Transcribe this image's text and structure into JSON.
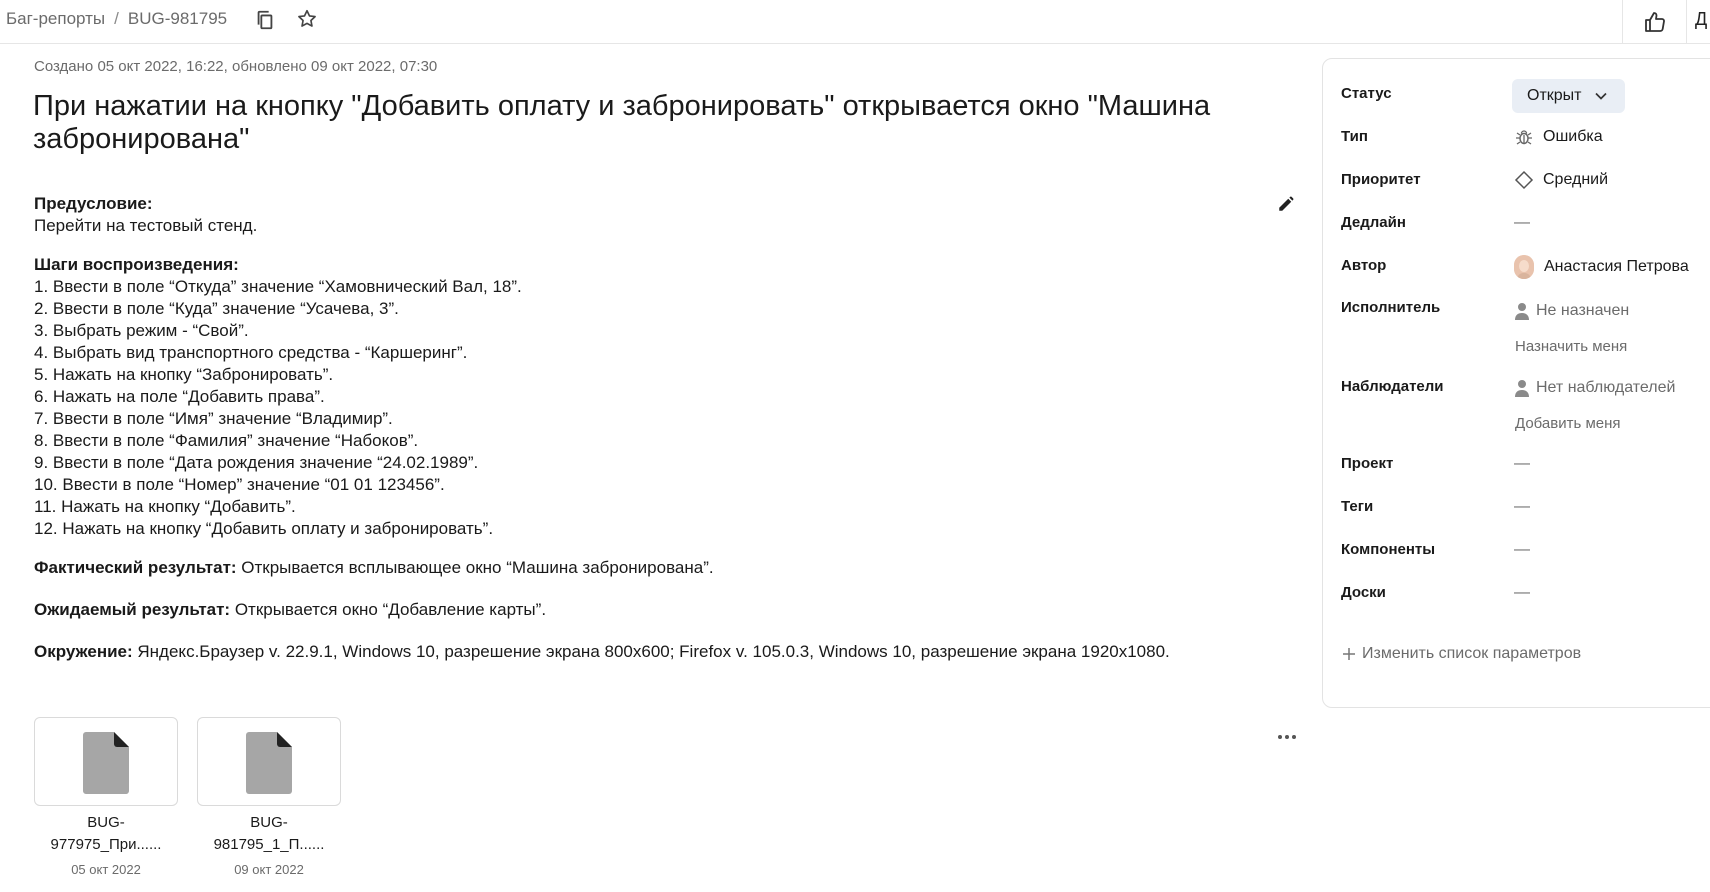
{
  "breadcrumb": {
    "section": "Баг-репорты",
    "separator": "/",
    "issue_key": "BUG-981795"
  },
  "topbar": {
    "edge_button_label": "Д"
  },
  "meta": {
    "text": "Создано 05 окт 2022, 16:22, обновлено 09 окт 2022, 07:30"
  },
  "title": "При нажатии на кнопку \"Добавить оплату и забронировать\" открывается окно \"Машина забронирована\"",
  "description": {
    "precondition_label": "Предусловие:",
    "precondition_text": "Перейти на тестовый стенд.",
    "steps_label": "Шаги воспроизведения:",
    "steps": [
      "1. Ввести в поле “Откуда” значение “Хамовнический Вал, 18”.",
      "2. Ввести в поле “Куда” значение “Усачева, 3”.",
      "3. Выбрать режим - “Свой”.",
      "4. Выбрать вид транспортного средства - “Каршеринг”.",
      "5. Нажать на кнопку “Забронировать”.",
      "6. Нажать на поле “Добавить права”.",
      "7. Ввести в поле “Имя” значение “Владимир”.",
      "8. Ввести в поле “Фамилия” значение “Набоков”.",
      "9. Ввести в поле “Дата рождения значение “24.02.1989”.",
      "10. Ввести в поле “Номер” значение “01 01 123456”.",
      "11. Нажать на кнопку “Добавить”.",
      "12. Нажать на кнопку “Добавить оплату и забронировать”."
    ],
    "actual_label": "Фактический результат:",
    "actual_text": " Открывается всплывающее окно “Машина забронирована”.",
    "expected_label": "Ожидаемый результат:",
    "expected_text": " Открывается окно “Добавление карты”.",
    "env_label": "Окружение:",
    "env_text": " Яндекс.Браузер v. 22.9.1, Windows 10, разрешение экрана 800x600; Firefox v. 105.0.3, Windows 10, разрешение экрана 1920x1080."
  },
  "attachments": [
    {
      "name_line1": "BUG-",
      "name_line2": "977975_При......",
      "date": "05 окт 2022",
      "icon": "file-icon"
    },
    {
      "name_line1": "BUG-",
      "name_line2": "981795_1_П......",
      "date": "09 окт 2022",
      "icon": "file-icon"
    }
  ],
  "sidebar": {
    "status": {
      "label": "Статус",
      "value": "Открыт"
    },
    "type": {
      "label": "Тип",
      "value": "Ошибка",
      "icon": "bug-icon"
    },
    "priority": {
      "label": "Приоритет",
      "value": "Средний",
      "icon": "diamond-icon"
    },
    "deadline": {
      "label": "Дедлайн",
      "value": "—"
    },
    "author": {
      "label": "Автор",
      "value": "Анастасия Петрова"
    },
    "assignee": {
      "label": "Исполнитель",
      "value": "Не назначен",
      "action": "Назначить меня"
    },
    "followers": {
      "label": "Наблюдатели",
      "value": "Нет наблюдателей",
      "action": "Добавить меня"
    },
    "project": {
      "label": "Проект",
      "value": "—"
    },
    "tags": {
      "label": "Теги",
      "value": "—"
    },
    "components": {
      "label": "Компоненты",
      "value": "—"
    },
    "boards": {
      "label": "Доски",
      "value": "—"
    },
    "change_params": "Изменить список параметров"
  },
  "colors": {
    "status_bg": "#e9eef5",
    "muted_text": "#6b6b6b",
    "file_icon": "#a6a6a6"
  }
}
